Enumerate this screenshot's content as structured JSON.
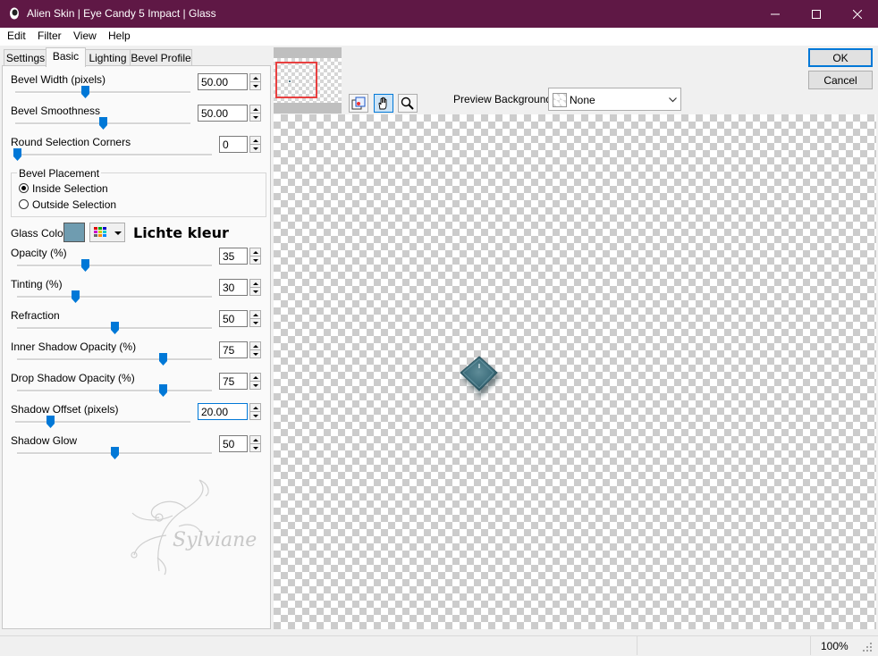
{
  "window": {
    "title": "Alien Skin | Eye Candy 5 Impact | Glass",
    "accent": "#5f1845"
  },
  "menu": [
    "Edit",
    "Filter",
    "View",
    "Help"
  ],
  "tabs": [
    "Settings",
    "Basic",
    "Lighting",
    "Bevel Profile"
  ],
  "active_tab": "Basic",
  "controls": {
    "bevel_width": {
      "label": "Bevel Width (pixels)",
      "value": "50.00",
      "slider_fraction": 0.4
    },
    "bevel_smoothness": {
      "label": "Bevel Smoothness",
      "value": "50.00",
      "slider_fraction": 0.5
    },
    "round_corners": {
      "label": "Round Selection Corners",
      "value": "0",
      "slider_fraction": 0.0
    },
    "bevel_placement": {
      "label": "Bevel Placement",
      "options": [
        "Inside Selection",
        "Outside Selection"
      ],
      "selected": "Inside Selection"
    },
    "glass_color": {
      "label": "Glass Color",
      "swatch": "#6f9cb0",
      "note": "Lichte kleur"
    },
    "opacity": {
      "label": "Opacity (%)",
      "value": "35",
      "slider_fraction": 0.35
    },
    "tinting": {
      "label": "Tinting (%)",
      "value": "30",
      "slider_fraction": 0.3
    },
    "refraction": {
      "label": "Refraction",
      "value": "50",
      "slider_fraction": 0.5
    },
    "inner_shadow_opacity": {
      "label": "Inner Shadow Opacity (%)",
      "value": "75",
      "slider_fraction": 0.75
    },
    "drop_shadow_opacity": {
      "label": "Drop Shadow Opacity (%)",
      "value": "75",
      "slider_fraction": 0.75
    },
    "shadow_offset": {
      "label": "Shadow Offset (pixels)",
      "value": "20.00",
      "slider_fraction": 0.2
    },
    "shadow_glow": {
      "label": "Shadow Glow",
      "value": "50",
      "slider_fraction": 0.5
    }
  },
  "watermark": "Sylviane",
  "buttons": {
    "ok": "OK",
    "cancel": "Cancel"
  },
  "preview": {
    "background_label": "Preview Background:",
    "background_value": "None",
    "tools": [
      "navigate-icon",
      "hand-icon",
      "zoom-icon"
    ]
  },
  "status": {
    "zoom": "100%"
  }
}
